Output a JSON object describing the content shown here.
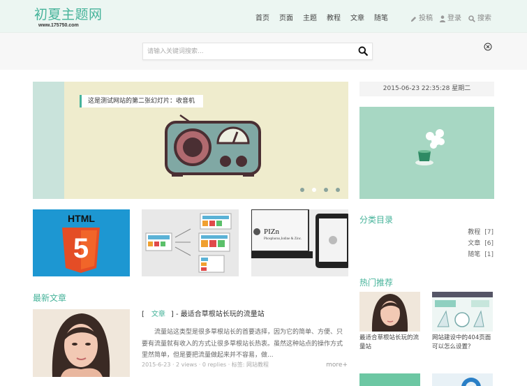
{
  "header": {
    "logo_title": "初夏主题网",
    "logo_url": "www.175750.com",
    "nav": [
      "首页",
      "页面",
      "主题",
      "教程",
      "文章",
      "随笔"
    ],
    "tools": [
      {
        "label": "投稿",
        "icon": "pencil-icon"
      },
      {
        "label": "登录",
        "icon": "user-icon"
      },
      {
        "label": "搜索",
        "icon": "search-icon"
      }
    ]
  },
  "search": {
    "placeholder": "请输入关键词搜索..."
  },
  "slider": {
    "caption": "这是测试网站的第二张幻灯片：收音机",
    "dot_count": 4,
    "active_dot": 2
  },
  "thumbs": [
    {
      "label": "HTML",
      "number": "5",
      "icon": "html5-logo"
    },
    {
      "icon": "responsive-layout-illustration"
    },
    {
      "label": "PIZn",
      "sub": "Phosphorus,Iodine & Zinc.",
      "icon": "devices-illustration"
    }
  ],
  "latest": {
    "title": "最新文章",
    "article": {
      "bracket_open": "[",
      "category": "文章",
      "bracket_close": "]",
      "title": "- 最适合草根站长玩的流量站",
      "excerpt": "流量站这类型是很多草根站长的首要选择，因为它的简单、方便、只要有流量就有收入的方式让很多草根站长热衷。虽然这种站点的操作方式里然简单，但是要把流量做起来并不容易，做...",
      "meta": "2015-6-23 · 2 views · 0 replies · 标签: 网站教程",
      "more": "more+"
    }
  },
  "sidebar": {
    "datetime": "2015-06-23 22:35:28 星期二",
    "category_title": "分类目录",
    "categories": [
      {
        "name": "教程",
        "count": "[7]"
      },
      {
        "name": "文章",
        "count": "[6]"
      },
      {
        "name": "随笔",
        "count": "[1]"
      }
    ],
    "hot_title": "热门推荐",
    "hot": [
      {
        "caption": "最适合草根站长玩的流量站"
      },
      {
        "caption": "网站建设中的404页面可以怎么设置？"
      }
    ]
  },
  "colors": {
    "accent": "#46b39a",
    "header_bg": "#ecf6f2",
    "slider_bg": "#efeccd",
    "html5_blue": "#1d97d2",
    "html5_orange": "#e44d26"
  }
}
